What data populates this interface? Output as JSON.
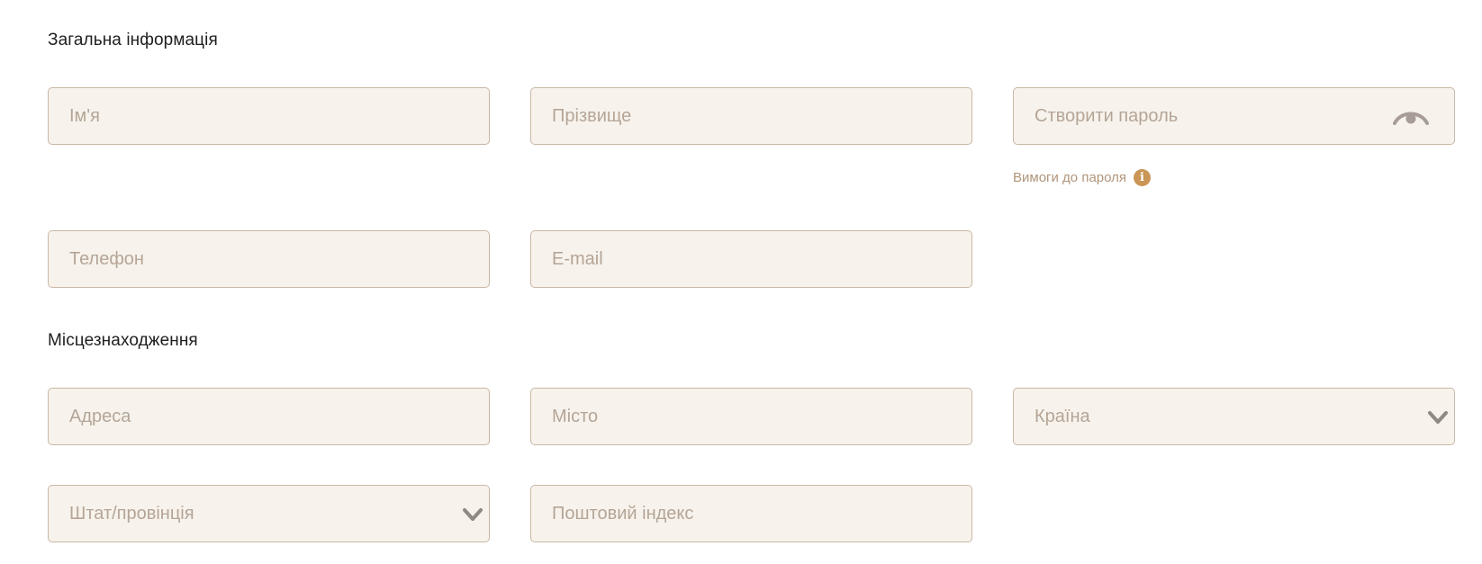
{
  "sections": {
    "general": "Загальна інформація",
    "location": "Місцезнаходження"
  },
  "fields": {
    "first_name": {
      "placeholder": "Ім'я"
    },
    "last_name": {
      "placeholder": "Прізвище"
    },
    "password": {
      "placeholder": "Створити пароль",
      "toggle_icon": "eye-icon"
    },
    "phone": {
      "placeholder": "Телефон"
    },
    "email": {
      "placeholder": "E-mail"
    },
    "address": {
      "placeholder": "Адреса"
    },
    "city": {
      "placeholder": "Місто"
    },
    "country": {
      "placeholder": "Країна",
      "icon": "chevron-down-icon"
    },
    "state": {
      "placeholder": "Штат/провінція",
      "icon": "chevron-down-icon"
    },
    "zip": {
      "placeholder": "Поштовий індекс"
    }
  },
  "password_requirements": {
    "label": "Вимоги до пароля",
    "icon": "info-icon",
    "icon_glyph": "i"
  },
  "colors": {
    "field_bg": "#f7f3ec",
    "field_border": "#c9b7a5",
    "placeholder": "#b5a597",
    "accent": "#c99655",
    "icon_gray": "#a79d96"
  }
}
